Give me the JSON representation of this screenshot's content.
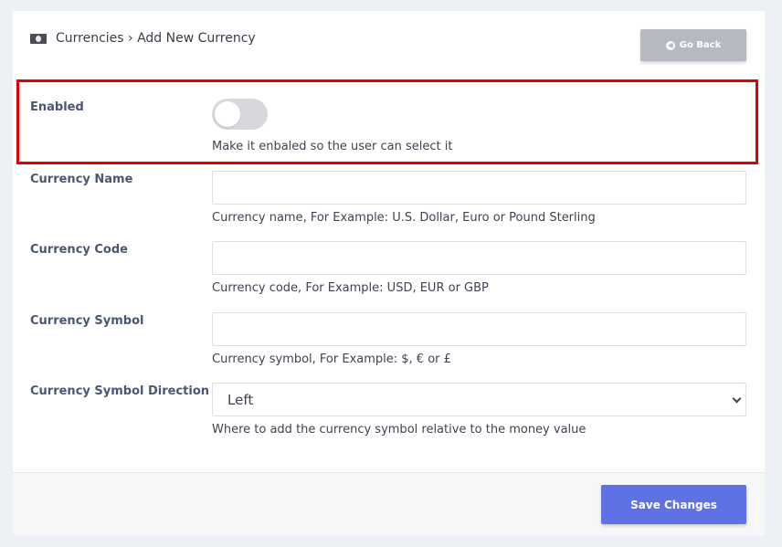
{
  "header": {
    "breadcrumb_icon": "money-icon",
    "breadcrumb": "Currencies › Add New Currency",
    "go_back_label": "Go Back"
  },
  "form": {
    "enabled": {
      "label": "Enabled",
      "value": false,
      "help": "Make it enbaled so the user can select it"
    },
    "currency_name": {
      "label": "Currency Name",
      "value": "",
      "help": "Currency name, For Example: U.S. Dollar, Euro or Pound Sterling"
    },
    "currency_code": {
      "label": "Currency Code",
      "value": "",
      "help": "Currency code, For Example: USD, EUR or GBP"
    },
    "currency_symbol": {
      "label": "Currency Symbol",
      "value": "",
      "help": "Currency symbol, For Example: $, € or £"
    },
    "symbol_direction": {
      "label": "Currency Symbol Direction",
      "selected": "Left",
      "help": "Where to add the currency symbol relative to the money value"
    }
  },
  "footer": {
    "save_label": "Save Changes"
  },
  "colors": {
    "primary": "#5e72e4",
    "secondary": "#b5bac2",
    "highlight": "#e20000",
    "background": "#edf1f6"
  }
}
